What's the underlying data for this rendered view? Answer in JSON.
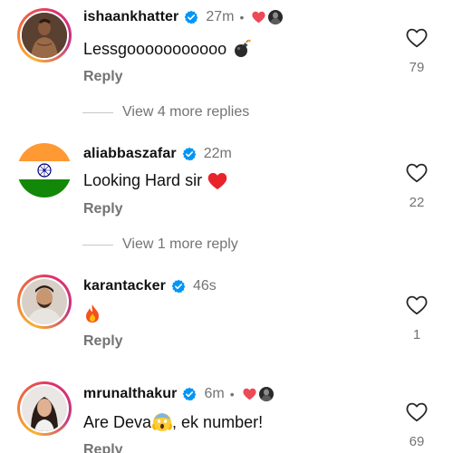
{
  "comments": [
    {
      "username": "ishaankhatter",
      "time": "27m",
      "dot": "•",
      "text": "Lessgooooooooooo",
      "reply": "Reply",
      "likes": "79",
      "view_more": "View 4 more replies"
    },
    {
      "username": "aliabbaszafar",
      "time": "22m",
      "text": "Looking Hard sir",
      "reply": "Reply",
      "likes": "22",
      "view_more": "View 1 more reply"
    },
    {
      "username": "karantacker",
      "time": "46s",
      "text": "",
      "reply": "Reply",
      "likes": "1"
    },
    {
      "username": "mrunalthakur",
      "time": "6m",
      "dot": "•",
      "text_before": "Are Deva",
      "text_after": ", ek number!",
      "reply": "Reply",
      "likes": "69"
    }
  ],
  "colors": {
    "verified": "#0095f6",
    "like_red": "#ed4956",
    "secondary_text": "#737373"
  },
  "icons": {
    "verified": "verified-badge-icon",
    "like": "heart-outline-icon",
    "bomb": "bomb-emoji-icon",
    "red_heart": "red-heart-emoji-icon",
    "fire": "fire-emoji-icon",
    "scream": "scream-emoji-icon"
  }
}
